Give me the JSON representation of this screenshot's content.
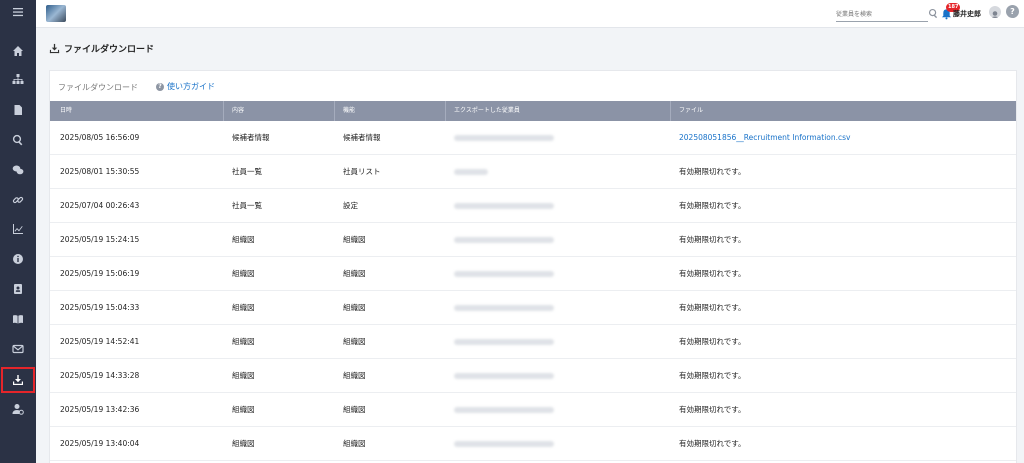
{
  "header": {
    "search_placeholder": "従業員を検索",
    "notification_count": "187",
    "user_name": "藤井史郎",
    "help_label": "?"
  },
  "page": {
    "title": "ファイルダウンロード"
  },
  "card": {
    "heading": "ファイルダウンロード",
    "guide_label": "使い方ガイド",
    "guide_icon": "?"
  },
  "table": {
    "columns": [
      "日時",
      "内容",
      "機能",
      "エクスポートした従業員",
      "ファイル"
    ],
    "rows": [
      {
        "datetime": "2025/08/05 16:56:09",
        "content": "候補者情報",
        "function": "候補者情報",
        "file": "202508051856__Recruitment Information.csv",
        "file_is_link": true
      },
      {
        "datetime": "2025/08/01 15:30:55",
        "content": "社員一覧",
        "function": "社員リスト",
        "file": "有効期限切れです。",
        "file_is_link": false
      },
      {
        "datetime": "2025/07/04 00:26:43",
        "content": "社員一覧",
        "function": "設定",
        "file": "有効期限切れです。",
        "file_is_link": false
      },
      {
        "datetime": "2025/05/19 15:24:15",
        "content": "組織図",
        "function": "組織図",
        "file": "有効期限切れです。",
        "file_is_link": false
      },
      {
        "datetime": "2025/05/19 15:06:19",
        "content": "組織図",
        "function": "組織図",
        "file": "有効期限切れです。",
        "file_is_link": false
      },
      {
        "datetime": "2025/05/19 15:04:33",
        "content": "組織図",
        "function": "組織図",
        "file": "有効期限切れです。",
        "file_is_link": false
      },
      {
        "datetime": "2025/05/19 14:52:41",
        "content": "組織図",
        "function": "組織図",
        "file": "有効期限切れです。",
        "file_is_link": false
      },
      {
        "datetime": "2025/05/19 14:33:28",
        "content": "組織図",
        "function": "組織図",
        "file": "有効期限切れです。",
        "file_is_link": false
      },
      {
        "datetime": "2025/05/19 13:42:36",
        "content": "組織図",
        "function": "組織図",
        "file": "有効期限切れです。",
        "file_is_link": false
      },
      {
        "datetime": "2025/05/19 13:40:04",
        "content": "組織図",
        "function": "組織図",
        "file": "有効期限切れです。",
        "file_is_link": false
      }
    ]
  },
  "sidebar": {
    "items": [
      {
        "name": "menu-icon"
      },
      {
        "name": "home-icon"
      },
      {
        "name": "org-chart-icon"
      },
      {
        "name": "document-icon"
      },
      {
        "name": "search-icon"
      },
      {
        "name": "chat-icon"
      },
      {
        "name": "link-icon"
      },
      {
        "name": "chart-icon"
      },
      {
        "name": "info-icon"
      },
      {
        "name": "profile-card-icon"
      },
      {
        "name": "book-icon"
      },
      {
        "name": "mail-icon"
      },
      {
        "name": "download-icon",
        "active": true
      },
      {
        "name": "user-settings-icon"
      }
    ]
  },
  "colors": {
    "sidebar_bg": "#2b3245",
    "active_outline": "#e5252a",
    "link": "#1a73c9",
    "table_header": "#8b93a6",
    "badge": "#e5252a"
  }
}
